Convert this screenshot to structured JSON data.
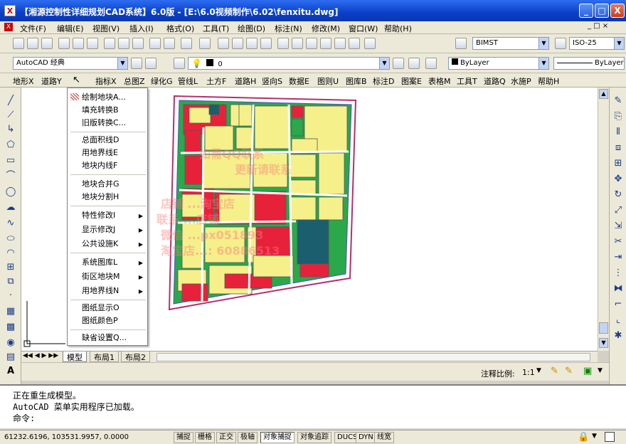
{
  "window": {
    "title": "【湘源控制性详细规划CAD系统】6.0版 - [E:\\6.0视频制作\\6.02\\fenxitu.dwg]",
    "minimize": "_",
    "maximize": "□",
    "close": "X"
  },
  "menubar": {
    "items": [
      "文件(F)",
      "编辑(E)",
      "视图(V)",
      "插入(I)",
      "格式(O)",
      "工具(T)",
      "绘图(D)",
      "标注(N)",
      "修改(M)",
      "窗口(W)",
      "帮助(H)"
    ]
  },
  "toolbar": {
    "workspace": "AutoCAD 经典",
    "layer": "0",
    "color": "ByLayer",
    "linetype": "ByLayer",
    "textstyle": "BIMST",
    "dimstyle": "ISO-25"
  },
  "custom_menu": {
    "items": [
      "地形X",
      "道路Y",
      "指标X",
      "总图Z",
      "绿化G",
      "管线L",
      "土方F",
      "道路H",
      "竖向S",
      "数据E",
      "图则U",
      "图库B",
      "标注D",
      "图案E",
      "表格M",
      "工具T",
      "道路Q",
      "水施P",
      "帮助H"
    ]
  },
  "dropdown": {
    "items": [
      {
        "label": "绘制地块A...",
        "sub": false
      },
      {
        "label": "填充转换B",
        "sub": false
      },
      {
        "label": "旧版转换C...",
        "sub": false
      },
      {
        "label": "总面积线D",
        "sub": false
      },
      {
        "label": "用地界线E",
        "sub": false
      },
      {
        "label": "地块内线F",
        "sub": false
      },
      {
        "label": "地块合并G",
        "sub": false
      },
      {
        "label": "地块分割H",
        "sub": false
      },
      {
        "label": "特性修改I",
        "sub": true
      },
      {
        "label": "显示修改J",
        "sub": true
      },
      {
        "label": "公共设施K",
        "sub": true
      },
      {
        "label": "系统图库L",
        "sub": true
      },
      {
        "label": "街区地块M",
        "sub": true
      },
      {
        "label": "用地界线N",
        "sub": true
      },
      {
        "label": "图纸显示O",
        "sub": false
      },
      {
        "label": "图纸颜色P",
        "sub": false
      },
      {
        "label": "缺省设置Q...",
        "sub": false
      }
    ]
  },
  "tabs": {
    "model": "模型",
    "layout1": "布局1",
    "layout2": "布局2"
  },
  "annotation": {
    "scale_label": "注释比例:",
    "scale_value": "1:1"
  },
  "command": {
    "lines": [
      "正在重生成模型。",
      "AutoCAD 菜单实用程序已加载。",
      "命令:"
    ]
  },
  "status": {
    "coords": "61232.6196, 103531.9957, 0.0000",
    "buttons": [
      {
        "label": "捕捉",
        "on": false
      },
      {
        "label": "栅格",
        "on": false
      },
      {
        "label": "正交",
        "on": false
      },
      {
        "label": "极轴",
        "on": false
      },
      {
        "label": "对象捕捉",
        "on": true
      },
      {
        "label": "对象追踪",
        "on": false
      },
      {
        "label": "DUCS",
        "on": false
      },
      {
        "label": "DYN",
        "on": false
      },
      {
        "label": "线宽",
        "on": false
      }
    ]
  },
  "watermark": {
    "lines": [
      "如需QQ联系",
      "更新请联系",
      "店铺 ...淘宝店",
      "联系  ...店铺",
      "微信 ...px051893",
      "淘宝店...: 60886513"
    ]
  },
  "colors": {
    "residential": "#f5f08a",
    "commercial": "#e8213b",
    "industrial": "#1b5e6e",
    "green": "#2ba84a",
    "road": "#ffffff",
    "titlebar": "#0a3fc8"
  }
}
